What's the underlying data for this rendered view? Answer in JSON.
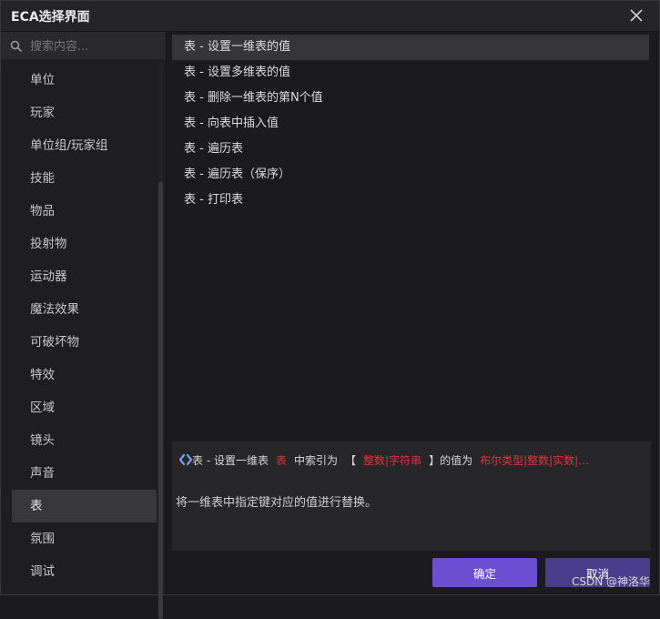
{
  "window": {
    "title": "ECA选择界面"
  },
  "sidebar": {
    "search_placeholder": "搜索内容...",
    "items": [
      {
        "label": "单位"
      },
      {
        "label": "玩家"
      },
      {
        "label": "单位组/玩家组"
      },
      {
        "label": "技能"
      },
      {
        "label": "物品"
      },
      {
        "label": "投射物"
      },
      {
        "label": "运动器"
      },
      {
        "label": "魔法效果"
      },
      {
        "label": "可破坏物"
      },
      {
        "label": "特效"
      },
      {
        "label": "区域"
      },
      {
        "label": "镜头"
      },
      {
        "label": "声音"
      },
      {
        "label": "表",
        "selected": true
      },
      {
        "label": "氛围"
      },
      {
        "label": "调试"
      }
    ]
  },
  "actions": [
    {
      "label": "表 - 设置一维表的值",
      "selected": true
    },
    {
      "label": "表 - 设置多维表的值"
    },
    {
      "label": "表 - 删除一维表的第N个值"
    },
    {
      "label": "表 - 向表中插入值"
    },
    {
      "label": "表 - 遍历表"
    },
    {
      "label": "表 - 遍历表（保序）"
    },
    {
      "label": "表 - 打印表"
    }
  ],
  "description": {
    "signature": {
      "prefix": "表 - 设置一维表",
      "param_table": "表",
      "mid": "中索引为",
      "bracket_open": "【",
      "param_key": "整数|字符串",
      "bracket_close": "】的值为",
      "param_value": "布尔类型|整数|实数|..."
    },
    "text": "将一维表中指定键对应的值进行替换。"
  },
  "buttons": {
    "ok": "确定",
    "cancel": "取消"
  },
  "watermark": "CSDN @神洛华",
  "colors": {
    "accent": "#6a4fd3",
    "param_red": "#e0343c",
    "icon_blue": "#7aa2ff"
  }
}
